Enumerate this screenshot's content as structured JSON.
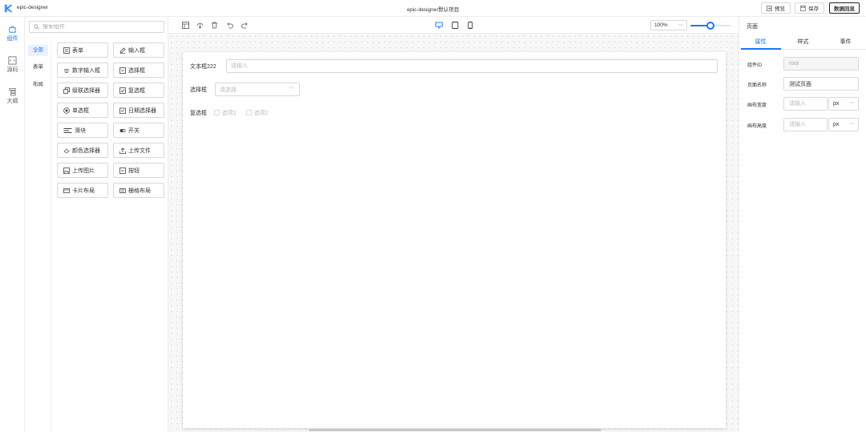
{
  "header": {
    "app_name": "epic-designer",
    "project_title": "epic-designer默认项目",
    "preview_label": "预览",
    "save_label": "保存",
    "data_echo_label": "数据回显"
  },
  "rail": {
    "components_label": "组件",
    "source_label": "源码",
    "outline_label": "大纲"
  },
  "panel": {
    "search_placeholder": "搜索组件",
    "categories": [
      "全部",
      "表单",
      "布局"
    ],
    "components": [
      {
        "label": "表单",
        "icon": "form-icon"
      },
      {
        "label": "输入框",
        "icon": "edit-icon"
      },
      {
        "label": "数字输入框",
        "icon": "number-input-icon"
      },
      {
        "label": "选择框",
        "icon": "select-icon"
      },
      {
        "label": "级联选择器",
        "icon": "cascader-icon"
      },
      {
        "label": "复选框",
        "icon": "checkbox-icon"
      },
      {
        "label": "单选框",
        "icon": "radio-icon"
      },
      {
        "label": "日期选择器",
        "icon": "calendar-icon"
      },
      {
        "label": "滑块",
        "icon": "slider-icon"
      },
      {
        "label": "开关",
        "icon": "switch-icon"
      },
      {
        "label": "颜色选择器",
        "icon": "color-icon"
      },
      {
        "label": "上传文件",
        "icon": "upload-icon"
      },
      {
        "label": "上传图片",
        "icon": "image-icon"
      },
      {
        "label": "按钮",
        "icon": "button-icon"
      },
      {
        "label": "卡片布局",
        "icon": "card-icon"
      },
      {
        "label": "栅格布局",
        "icon": "grid-icon"
      }
    ]
  },
  "toolbar": {
    "zoom": "100%",
    "zoom_level": 0.5
  },
  "canvas": {
    "text_label": "文本框222",
    "text_placeholder": "请输入",
    "select_label": "选择框",
    "select_placeholder": "请选择",
    "checkbox_label": "复选框",
    "options": [
      "选项1",
      "选项2"
    ]
  },
  "props": {
    "title": "页面",
    "tabs": [
      "属性",
      "样式",
      "事件"
    ],
    "id_label": "组件ID",
    "id_value": "root",
    "name_label": "页面名称",
    "name_value": "测试页面",
    "width_label": "画布宽度",
    "width_placeholder": "请输入",
    "width_unit": "px",
    "height_label": "画布高度",
    "height_placeholder": "请输入",
    "height_unit": "px"
  },
  "colors": {
    "accent": "#1677ff"
  }
}
